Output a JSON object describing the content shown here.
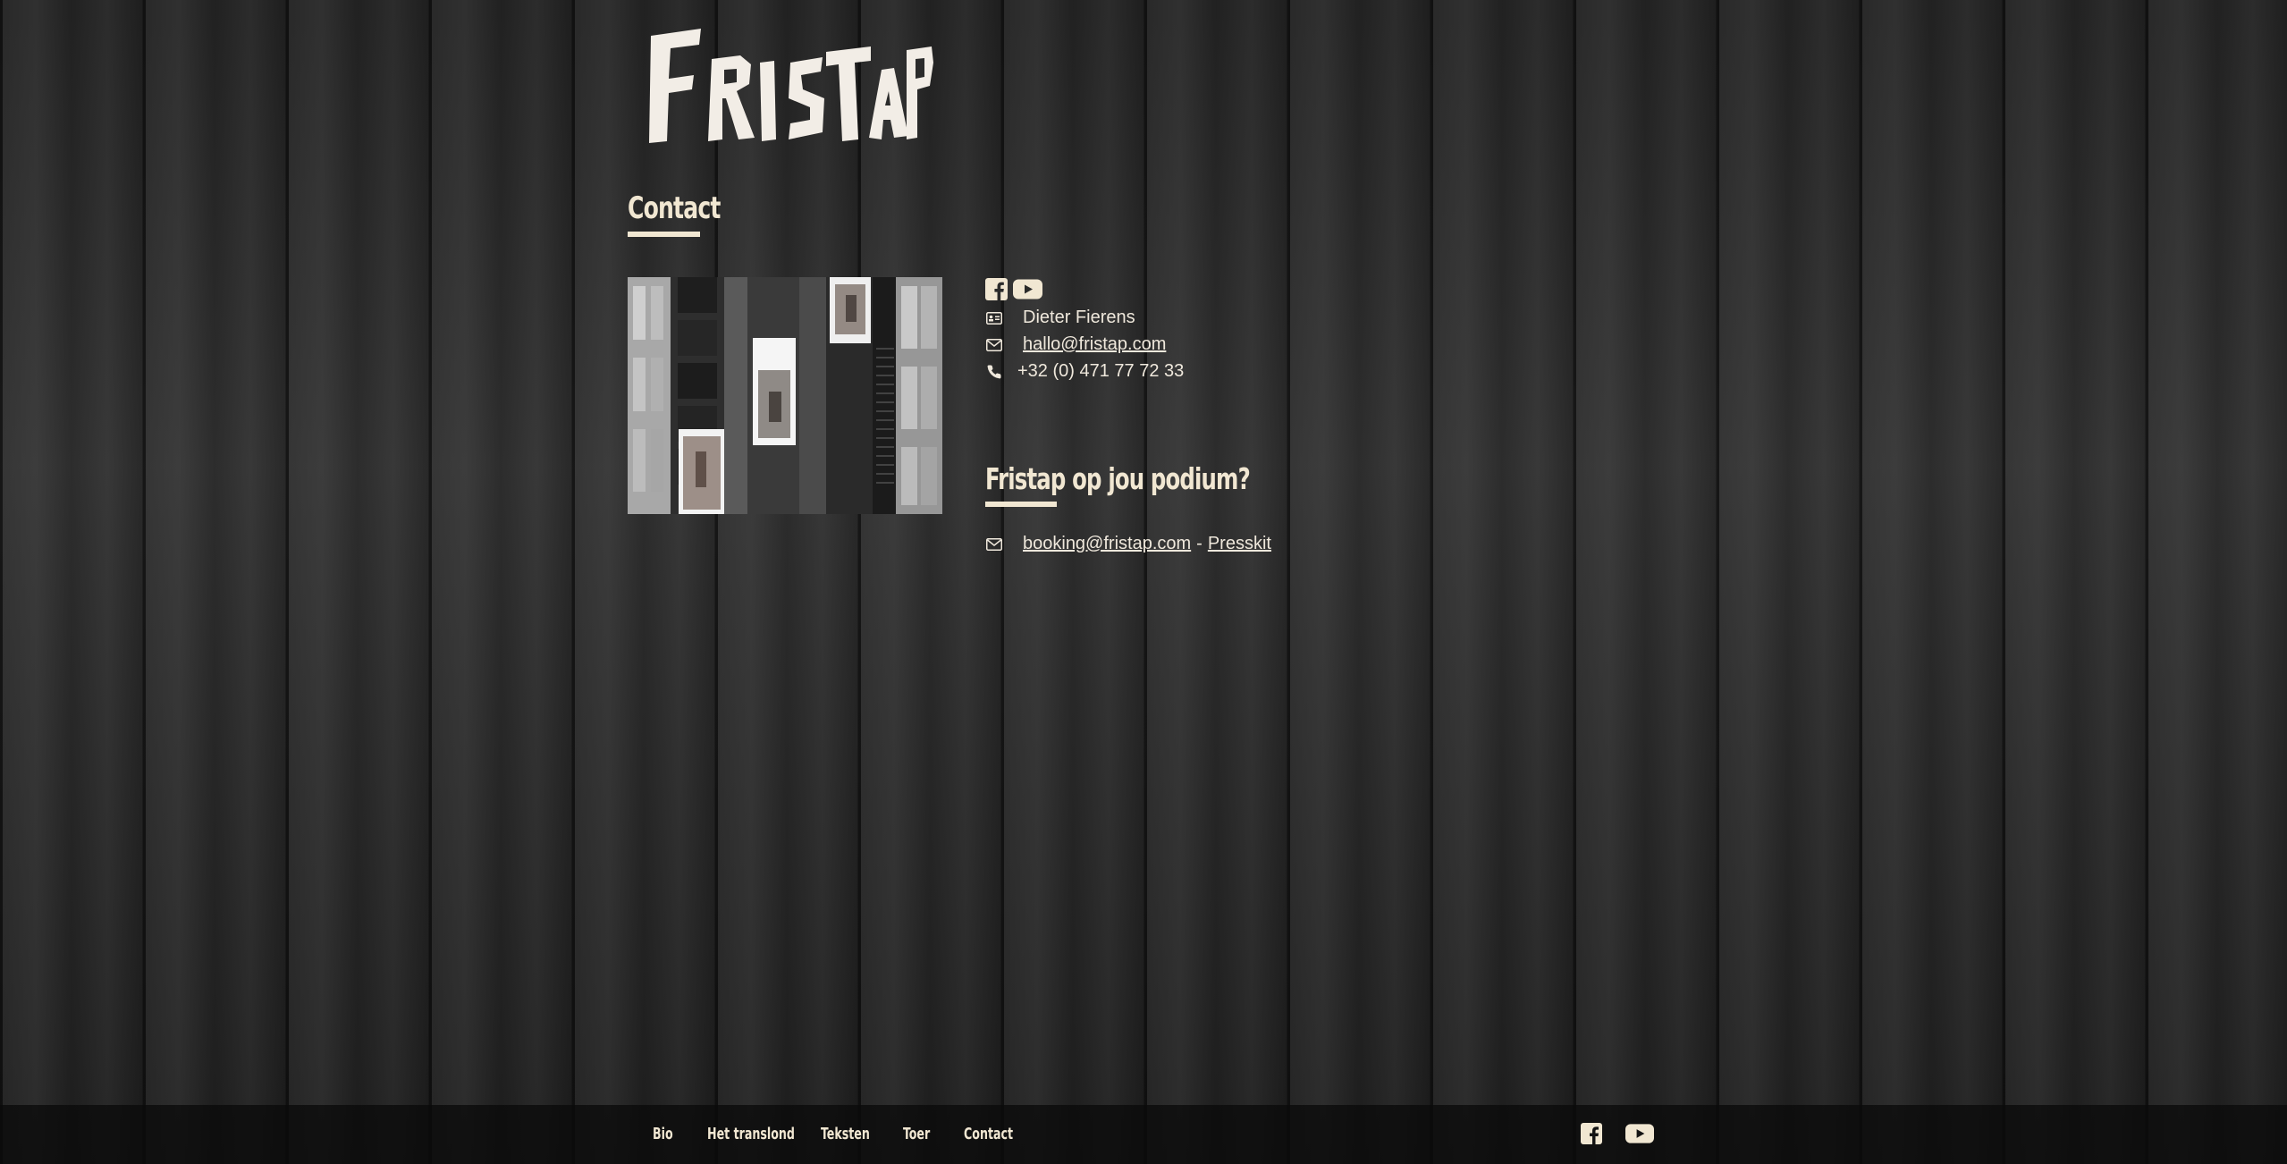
{
  "site": {
    "logo_text": "FRISTAP"
  },
  "contact": {
    "title": "Contact",
    "name": "Dieter Fierens",
    "email": "hallo@fristap.com",
    "phone": "+32 (0) 471 77 72 33"
  },
  "booking": {
    "title": "Fristap op jou podium?",
    "email": "booking@fristap.com",
    "separator": "-",
    "presskit_label": "Presskit"
  },
  "social": {
    "facebook": "facebook-icon",
    "youtube": "youtube-icon"
  },
  "footer": {
    "nav": [
      "Bio",
      "Het translond",
      "Teksten",
      "Toer",
      "Contact"
    ]
  },
  "colors": {
    "text": "#efe8dc",
    "accent": "#f1e7d2",
    "footer_bg": "#0a0a0a"
  }
}
